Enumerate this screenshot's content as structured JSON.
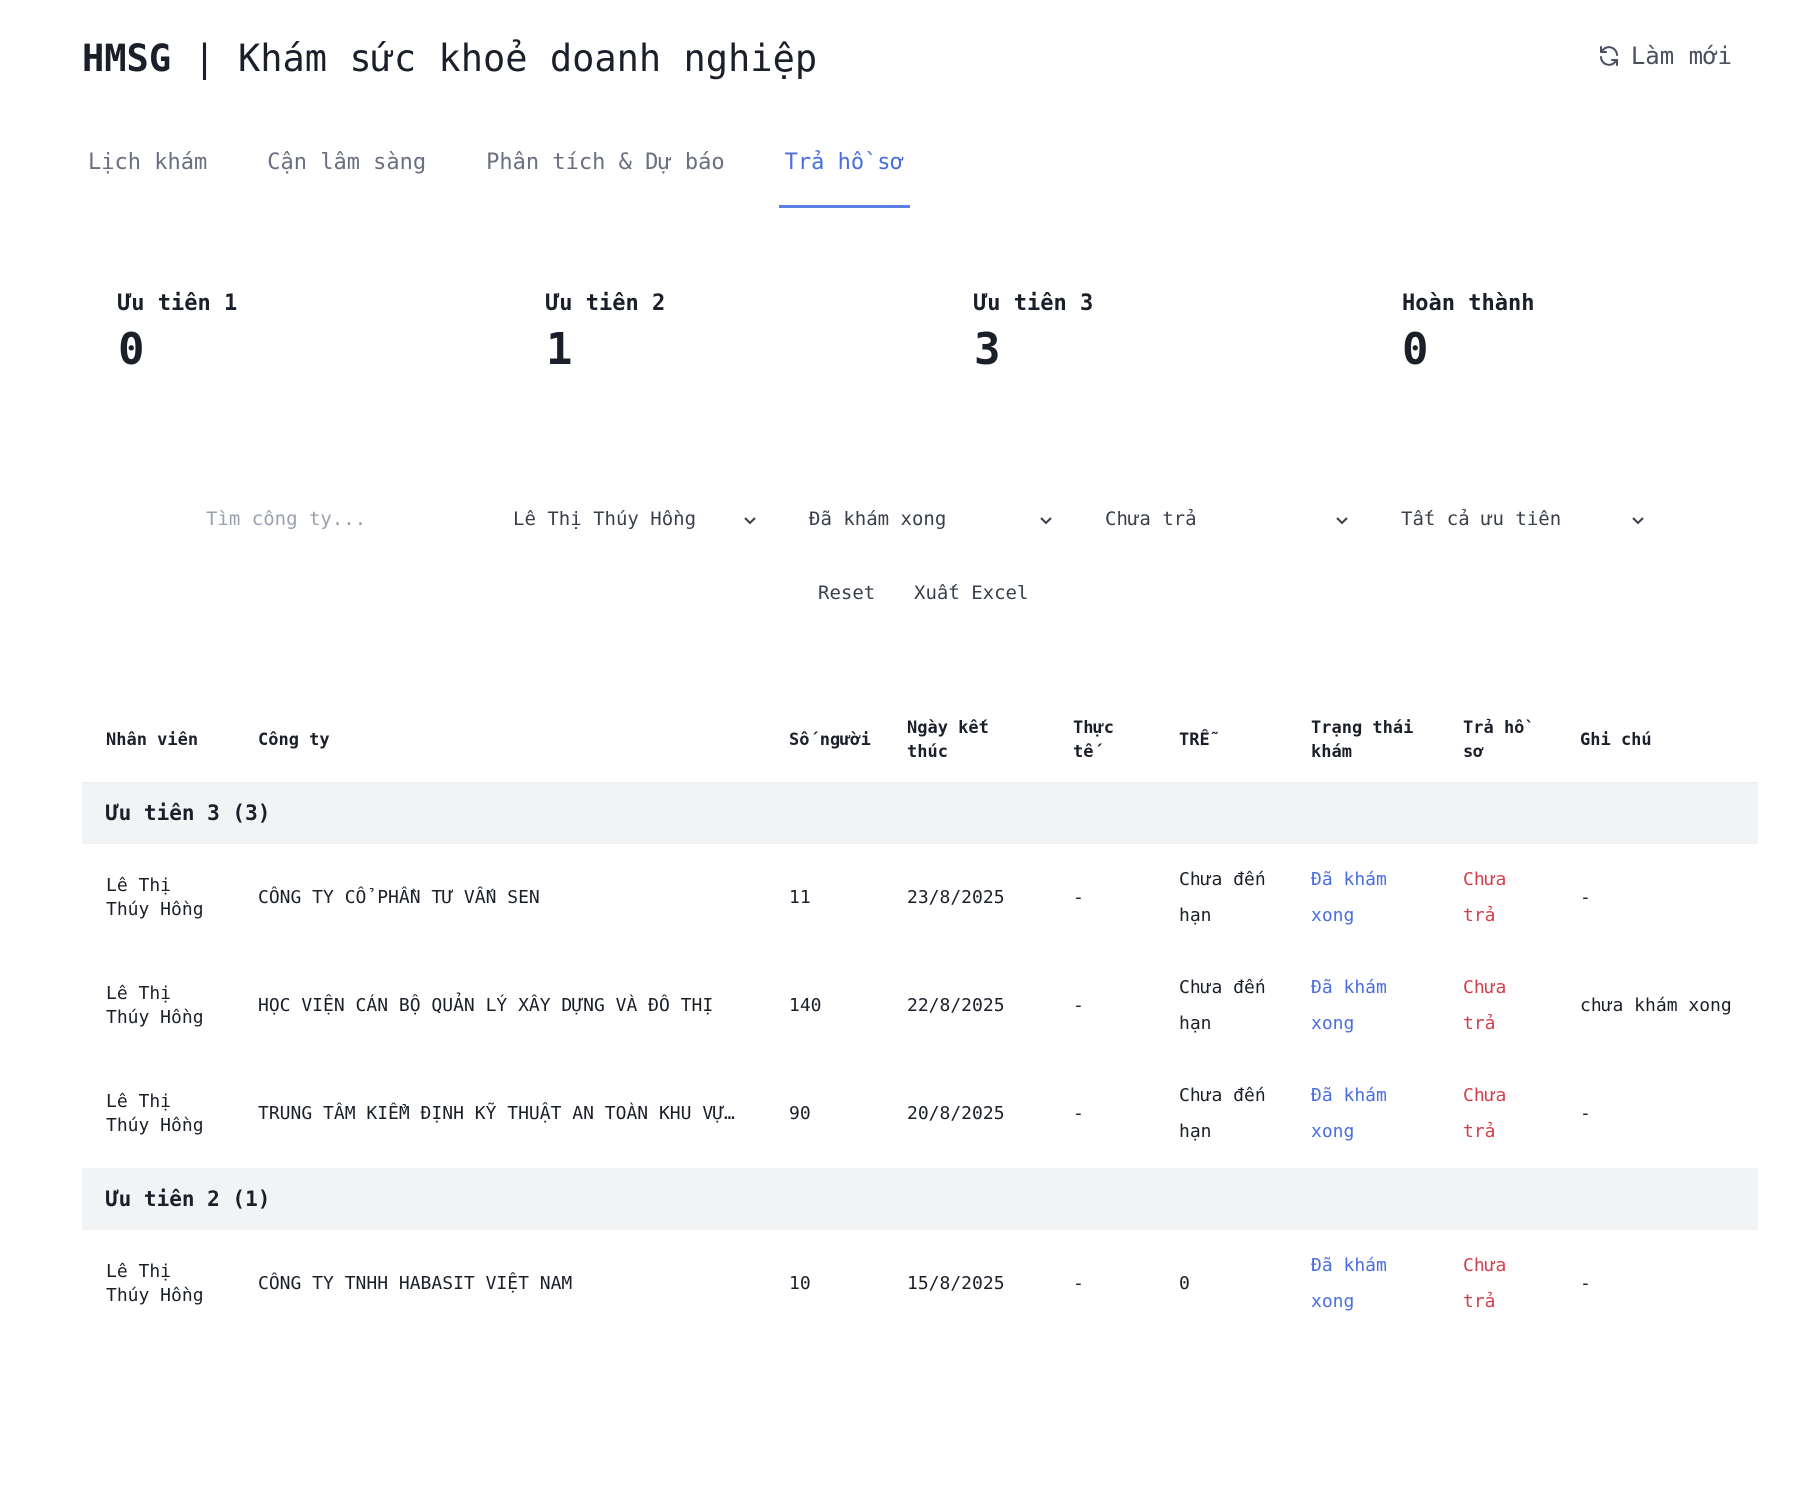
{
  "header": {
    "brand": "HMSG",
    "separator": "|",
    "title": "Khám sức khoẻ doanh nghiệp",
    "refresh_label": "Làm mới"
  },
  "tabs": [
    {
      "label": "Lịch khám"
    },
    {
      "label": "Cận lâm sàng"
    },
    {
      "label": "Phân tích & Dự báo"
    },
    {
      "label": "Trả hồ sơ"
    }
  ],
  "stats": [
    {
      "label": "Ưu tiên 1",
      "value": "0"
    },
    {
      "label": "Ưu tiên 2",
      "value": "1"
    },
    {
      "label": "Ưu tiên 3",
      "value": "3"
    },
    {
      "label": "Hoàn thành",
      "value": "0"
    }
  ],
  "filters": {
    "search_placeholder": "Tìm công ty...",
    "staff": "Lê Thị Thúy Hồng",
    "exam_status": "Đã khám xong",
    "return_status": "Chưa trả",
    "priority": "Tất cả ưu tiên",
    "reset_label": "Reset",
    "export_label": "Xuất Excel"
  },
  "table": {
    "headers": {
      "staff": "Nhân viên",
      "company": "Công ty",
      "people": "Số người",
      "end_date": "Ngày kết thúc",
      "actual": "Thực tế",
      "late": "TRỄ",
      "exam_status": "Trạng thái khám",
      "returned": "Trả hồ sơ",
      "note": "Ghi chú"
    },
    "groups": [
      {
        "title": "Ưu tiên 3 (3)",
        "rows": [
          {
            "staff": "Lê Thị Thúy Hồng",
            "company": "CÔNG TY CỔ PHẦN TƯ VẤN SEN",
            "people": "11",
            "end_date": "23/8/2025",
            "actual": "-",
            "late": "Chưa đến hạn",
            "exam_status": "Đã khám xong",
            "returned": "Chưa trả",
            "note": "-"
          },
          {
            "staff": "Lê Thị Thúy Hồng",
            "company": "HỌC VIỆN CÁN BỘ QUẢN LÝ XÂY DỰNG VÀ ĐÔ THỊ",
            "people": "140",
            "end_date": "22/8/2025",
            "actual": "-",
            "late": "Chưa đến hạn",
            "exam_status": "Đã khám xong",
            "returned": "Chưa trả",
            "note": "chưa khám xong"
          },
          {
            "staff": "Lê Thị Thúy Hồng",
            "company": "TRUNG TÂM KIỂM ĐỊNH KỸ THUẬT AN TOÀN KHU VỰ…",
            "people": "90",
            "end_date": "20/8/2025",
            "actual": "-",
            "late": "Chưa đến hạn",
            "exam_status": "Đã khám xong",
            "returned": "Chưa trả",
            "note": "-"
          }
        ]
      },
      {
        "title": "Ưu tiên 2 (1)",
        "rows": [
          {
            "staff": "Lê Thị Thúy Hồng",
            "company": "CÔNG TY TNHH HABASIT VIỆT NAM",
            "people": "10",
            "end_date": "15/8/2025",
            "actual": "-",
            "late": "0",
            "exam_status": "Đã khám xong",
            "returned": "Chưa trả",
            "note": "-"
          }
        ]
      }
    ]
  },
  "colors": {
    "accent": "#4a6ee0",
    "danger": "#d2404c",
    "group_bg": "#f2f3f5"
  }
}
